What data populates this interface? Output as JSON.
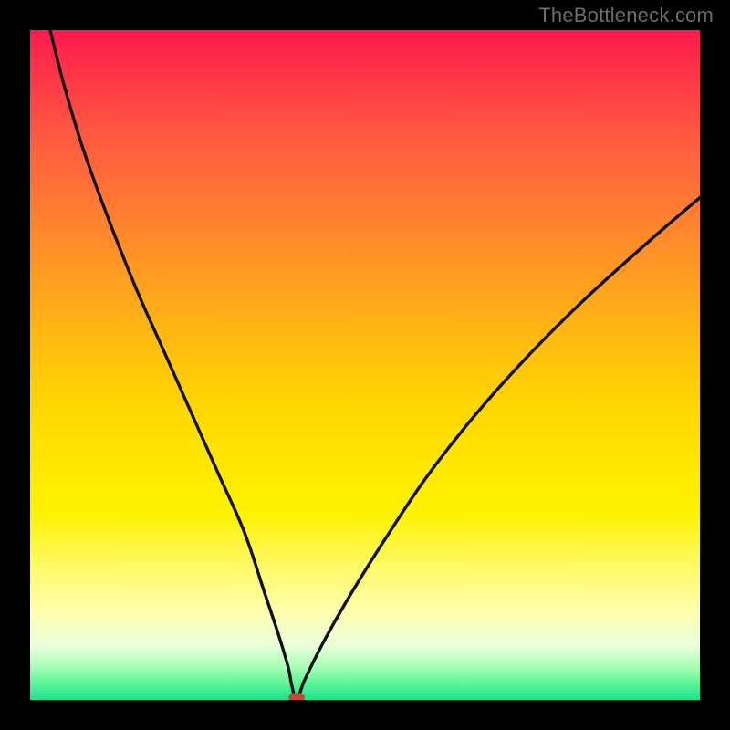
{
  "watermark": "TheBottleneck.com",
  "colors": {
    "curve_stroke": "#111111",
    "marker_fill": "#c3493f",
    "frame_bg": "#000000"
  },
  "chart_data": {
    "type": "line",
    "title": "",
    "xlabel": "",
    "ylabel": "",
    "xlim": [
      0,
      100
    ],
    "ylim": [
      0,
      100
    ],
    "series": [
      {
        "name": "bottleneck-curve",
        "x": [
          3,
          5,
          8,
          12,
          16,
          20,
          24,
          28,
          32,
          35,
          37,
          38.5,
          39.1,
          39.8,
          41,
          44,
          48,
          53,
          59,
          66,
          74,
          83,
          93,
          100
        ],
        "y": [
          100,
          92,
          82,
          71,
          61,
          52,
          43,
          34,
          25,
          16,
          10,
          5,
          2,
          0,
          3,
          9,
          16,
          24,
          33,
          42,
          51,
          60,
          69,
          75
        ]
      }
    ],
    "marker": {
      "x": 39.8,
      "y": 0,
      "rx": 9,
      "ry": 5,
      "color": "#c3493f"
    },
    "grid": false,
    "legend": false
  }
}
